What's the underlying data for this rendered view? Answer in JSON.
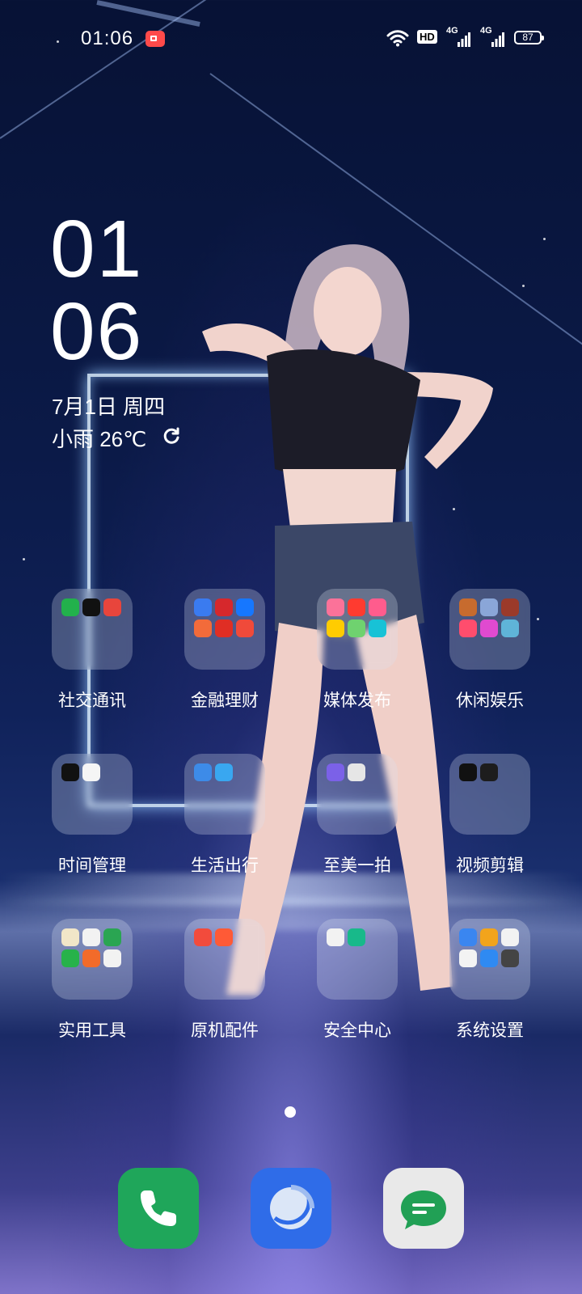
{
  "status_bar": {
    "time": "01:06",
    "network_badge": "HD",
    "sim1_type": "4G",
    "sim2_type": "4G",
    "battery_level": "87",
    "record_icon": "screen-record-icon",
    "wifi_icon": "wifi-icon"
  },
  "clock_widget": {
    "hour": "01",
    "minute": "06",
    "date": "7月1日 周四",
    "weather": "小雨 26℃",
    "refresh_icon": "refresh-icon"
  },
  "folders": [
    {
      "label": "社交通讯"
    },
    {
      "label": "金融理财"
    },
    {
      "label": "媒体发布"
    },
    {
      "label": "休闲娱乐"
    },
    {
      "label": "时间管理"
    },
    {
      "label": "生活出行"
    },
    {
      "label": "至美一拍"
    },
    {
      "label": "视频剪辑"
    },
    {
      "label": "实用工具"
    },
    {
      "label": "原机配件"
    },
    {
      "label": "安全中心"
    },
    {
      "label": "系统设置"
    }
  ],
  "page_indicator": {
    "current_page": 1,
    "total_pages": 1
  },
  "dock": [
    {
      "name": "phone-icon",
      "color": "#1fa65a"
    },
    {
      "name": "browser-icon",
      "color": "#2f6ce8"
    },
    {
      "name": "messages-icon",
      "color": "#e9e9e9"
    }
  ],
  "colors": {
    "record": "#ff4a4a",
    "folder_bg": "rgba(220,225,240,0.28)"
  }
}
